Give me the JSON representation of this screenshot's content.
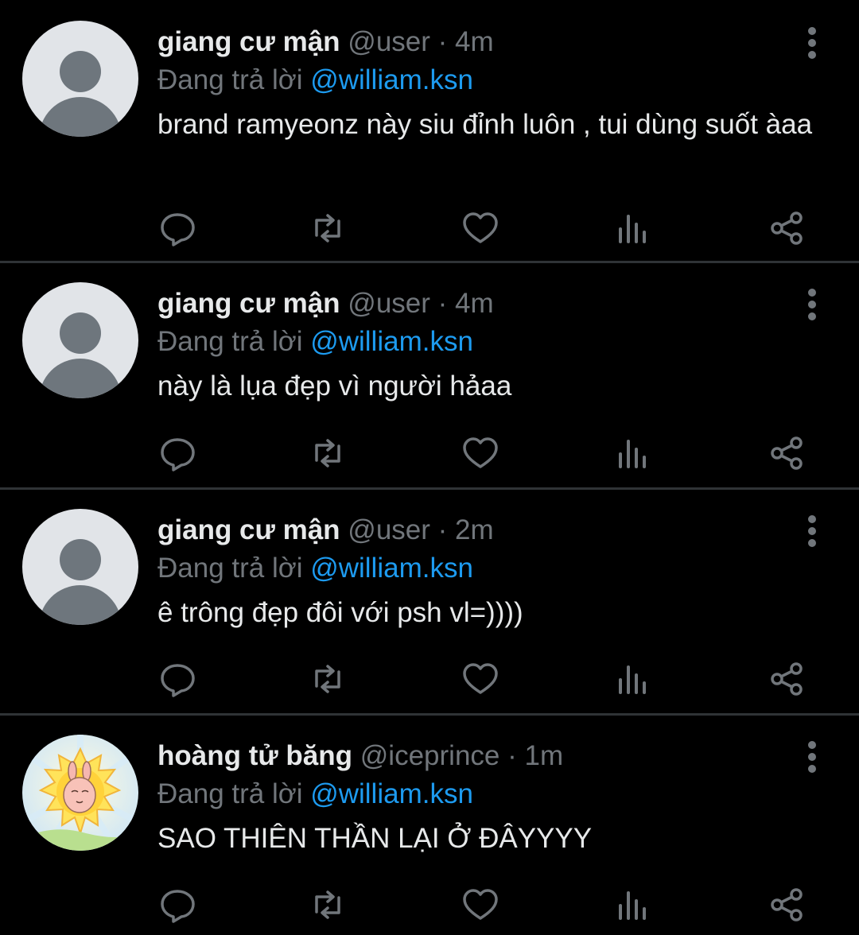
{
  "tweets": [
    {
      "display_name": "giang cư mận",
      "handle": "@user",
      "dot": "·",
      "time": "4m",
      "reply_prefix": "Đang trả lời",
      "reply_to": "@william.ksn",
      "text": "brand ramyeonz này siu đỉnh luôn , tui dùng suốt àaa",
      "avatar": "default-avatar"
    },
    {
      "display_name": "giang cư mận",
      "handle": "@user",
      "dot": "·",
      "time": "4m",
      "reply_prefix": "Đang trả lời",
      "reply_to": "@william.ksn",
      "text": "này là lụa đẹp vì người hảaa",
      "avatar": "default-avatar"
    },
    {
      "display_name": "giang cư mận",
      "handle": "@user",
      "dot": "·",
      "time": "2m",
      "reply_prefix": "Đang trả lời",
      "reply_to": "@william.ksn",
      "text": "ê trông đẹp đôi với psh vl=))))",
      "avatar": "default-avatar"
    },
    {
      "display_name": "hoàng tử băng",
      "handle": "@iceprince",
      "dot": "·",
      "time": "1m",
      "reply_prefix": "Đang trả lời",
      "reply_to": "@william.ksn",
      "text": "SAO THIÊN THẦN LẠI Ở ĐÂYYYY",
      "avatar": "sun-bunny-avatar"
    }
  ],
  "actions": [
    "reply-icon",
    "retweet-icon",
    "like-icon",
    "analytics-icon",
    "share-icon"
  ],
  "colors": {
    "background": "#000000",
    "text": "#e7e9ea",
    "muted": "#71767b",
    "accent": "#1d9bf0",
    "divider": "#2f3336"
  }
}
